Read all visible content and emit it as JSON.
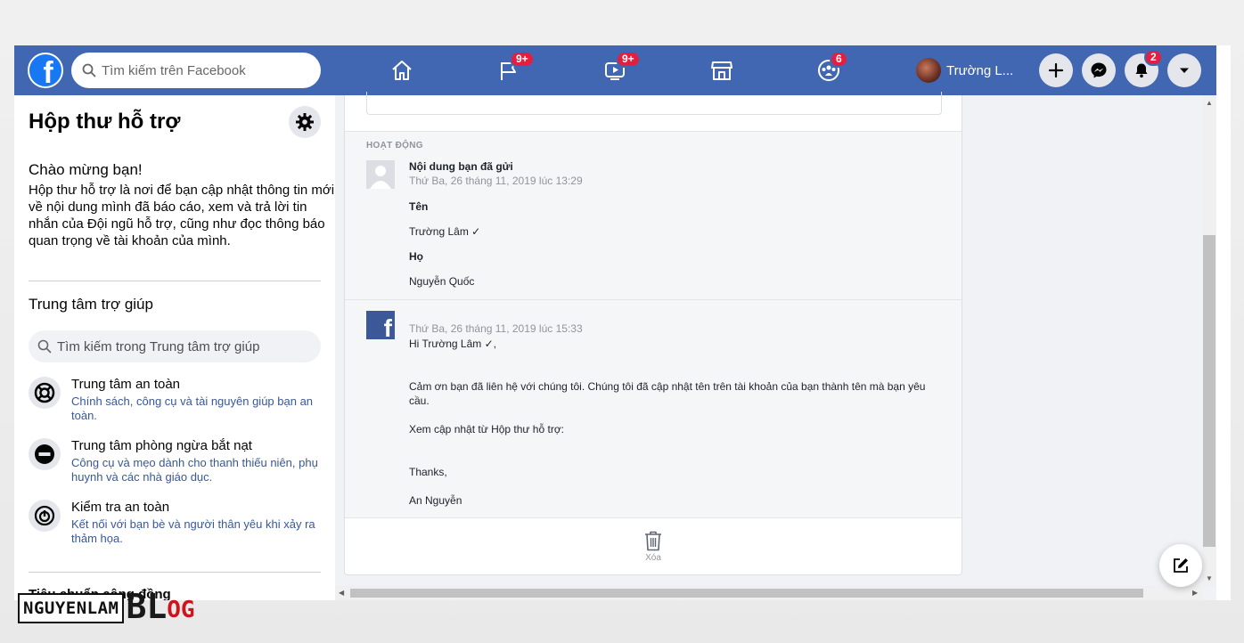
{
  "topbar": {
    "search_placeholder": "Tìm kiếm trên Facebook",
    "logo_letter": "f",
    "nav_badges": {
      "pages": "9+",
      "watch": "9+",
      "groups": "6"
    },
    "user_name": "Trường L...",
    "notifications_badge": "2"
  },
  "sidebar": {
    "title": "Hộp thư hỗ trợ",
    "welcome_title": "Chào mừng bạn!",
    "welcome_body": "Hộp thư hỗ trợ là nơi để bạn cập nhật thông tin mới về nội dung mình đã báo cáo, xem và trả lời tin nhắn của Đội ngũ hỗ trợ, cũng như đọc thông báo quan trọng về tài khoản của mình.",
    "help_title": "Trung tâm trợ giúp",
    "help_search_placeholder": "Tìm kiếm trong Trung tâm trợ giúp",
    "items": [
      {
        "title": "Trung tâm an toàn",
        "desc": "Chính sách, công cụ và tài nguyên giúp bạn an toàn.",
        "icon": "lifebuoy-icon"
      },
      {
        "title": "Trung tâm phòng ngừa bắt nạt",
        "desc": "Công cụ và mẹo dành cho thanh thiếu niên, phụ huynh và các nhà giáo dục.",
        "icon": "no-entry-icon"
      },
      {
        "title": "Kiểm tra an toàn",
        "desc": "Kết nối với bạn bè và người thân yêu khi xảy ra thảm họa.",
        "icon": "safety-check-icon"
      }
    ],
    "bottom_label": "Tiêu chuẩn cộng đồng"
  },
  "activity": {
    "label": "HOẠT ĐỘNG",
    "sent": {
      "title": "Nội dung bạn đã gửi",
      "date": "Thứ Ba, 26 tháng 11, 2019 lúc 13:29",
      "field1_label": "Tên",
      "field1_value": "Trường Lâm ✓",
      "field2_label": "Họ",
      "field2_value": "Nguyễn Quốc"
    },
    "reply": {
      "logo_letter": "f",
      "date": "Thứ Ba, 26 tháng 11, 2019 lúc 15:33",
      "greeting": "Hi Trường Lâm ✓,",
      "body": "Cảm ơn bạn đã liên hệ với chúng tôi. Chúng tôi đã cập nhật tên trên tài khoản của bạn thành tên mà bạn yêu cầu.",
      "update_line": "Xem cập nhật từ Hộp thư hỗ trợ:",
      "thanks": "Thanks,",
      "signature": "An Nguyễn"
    },
    "delete_label": "Xóa"
  },
  "watermark": {
    "left": "NGUYENLAM",
    "blog_big": "BL",
    "blog_small": "OG"
  },
  "colors": {
    "topbar": "#4267b2",
    "badge": "#e41e3f",
    "link": "#385898"
  }
}
